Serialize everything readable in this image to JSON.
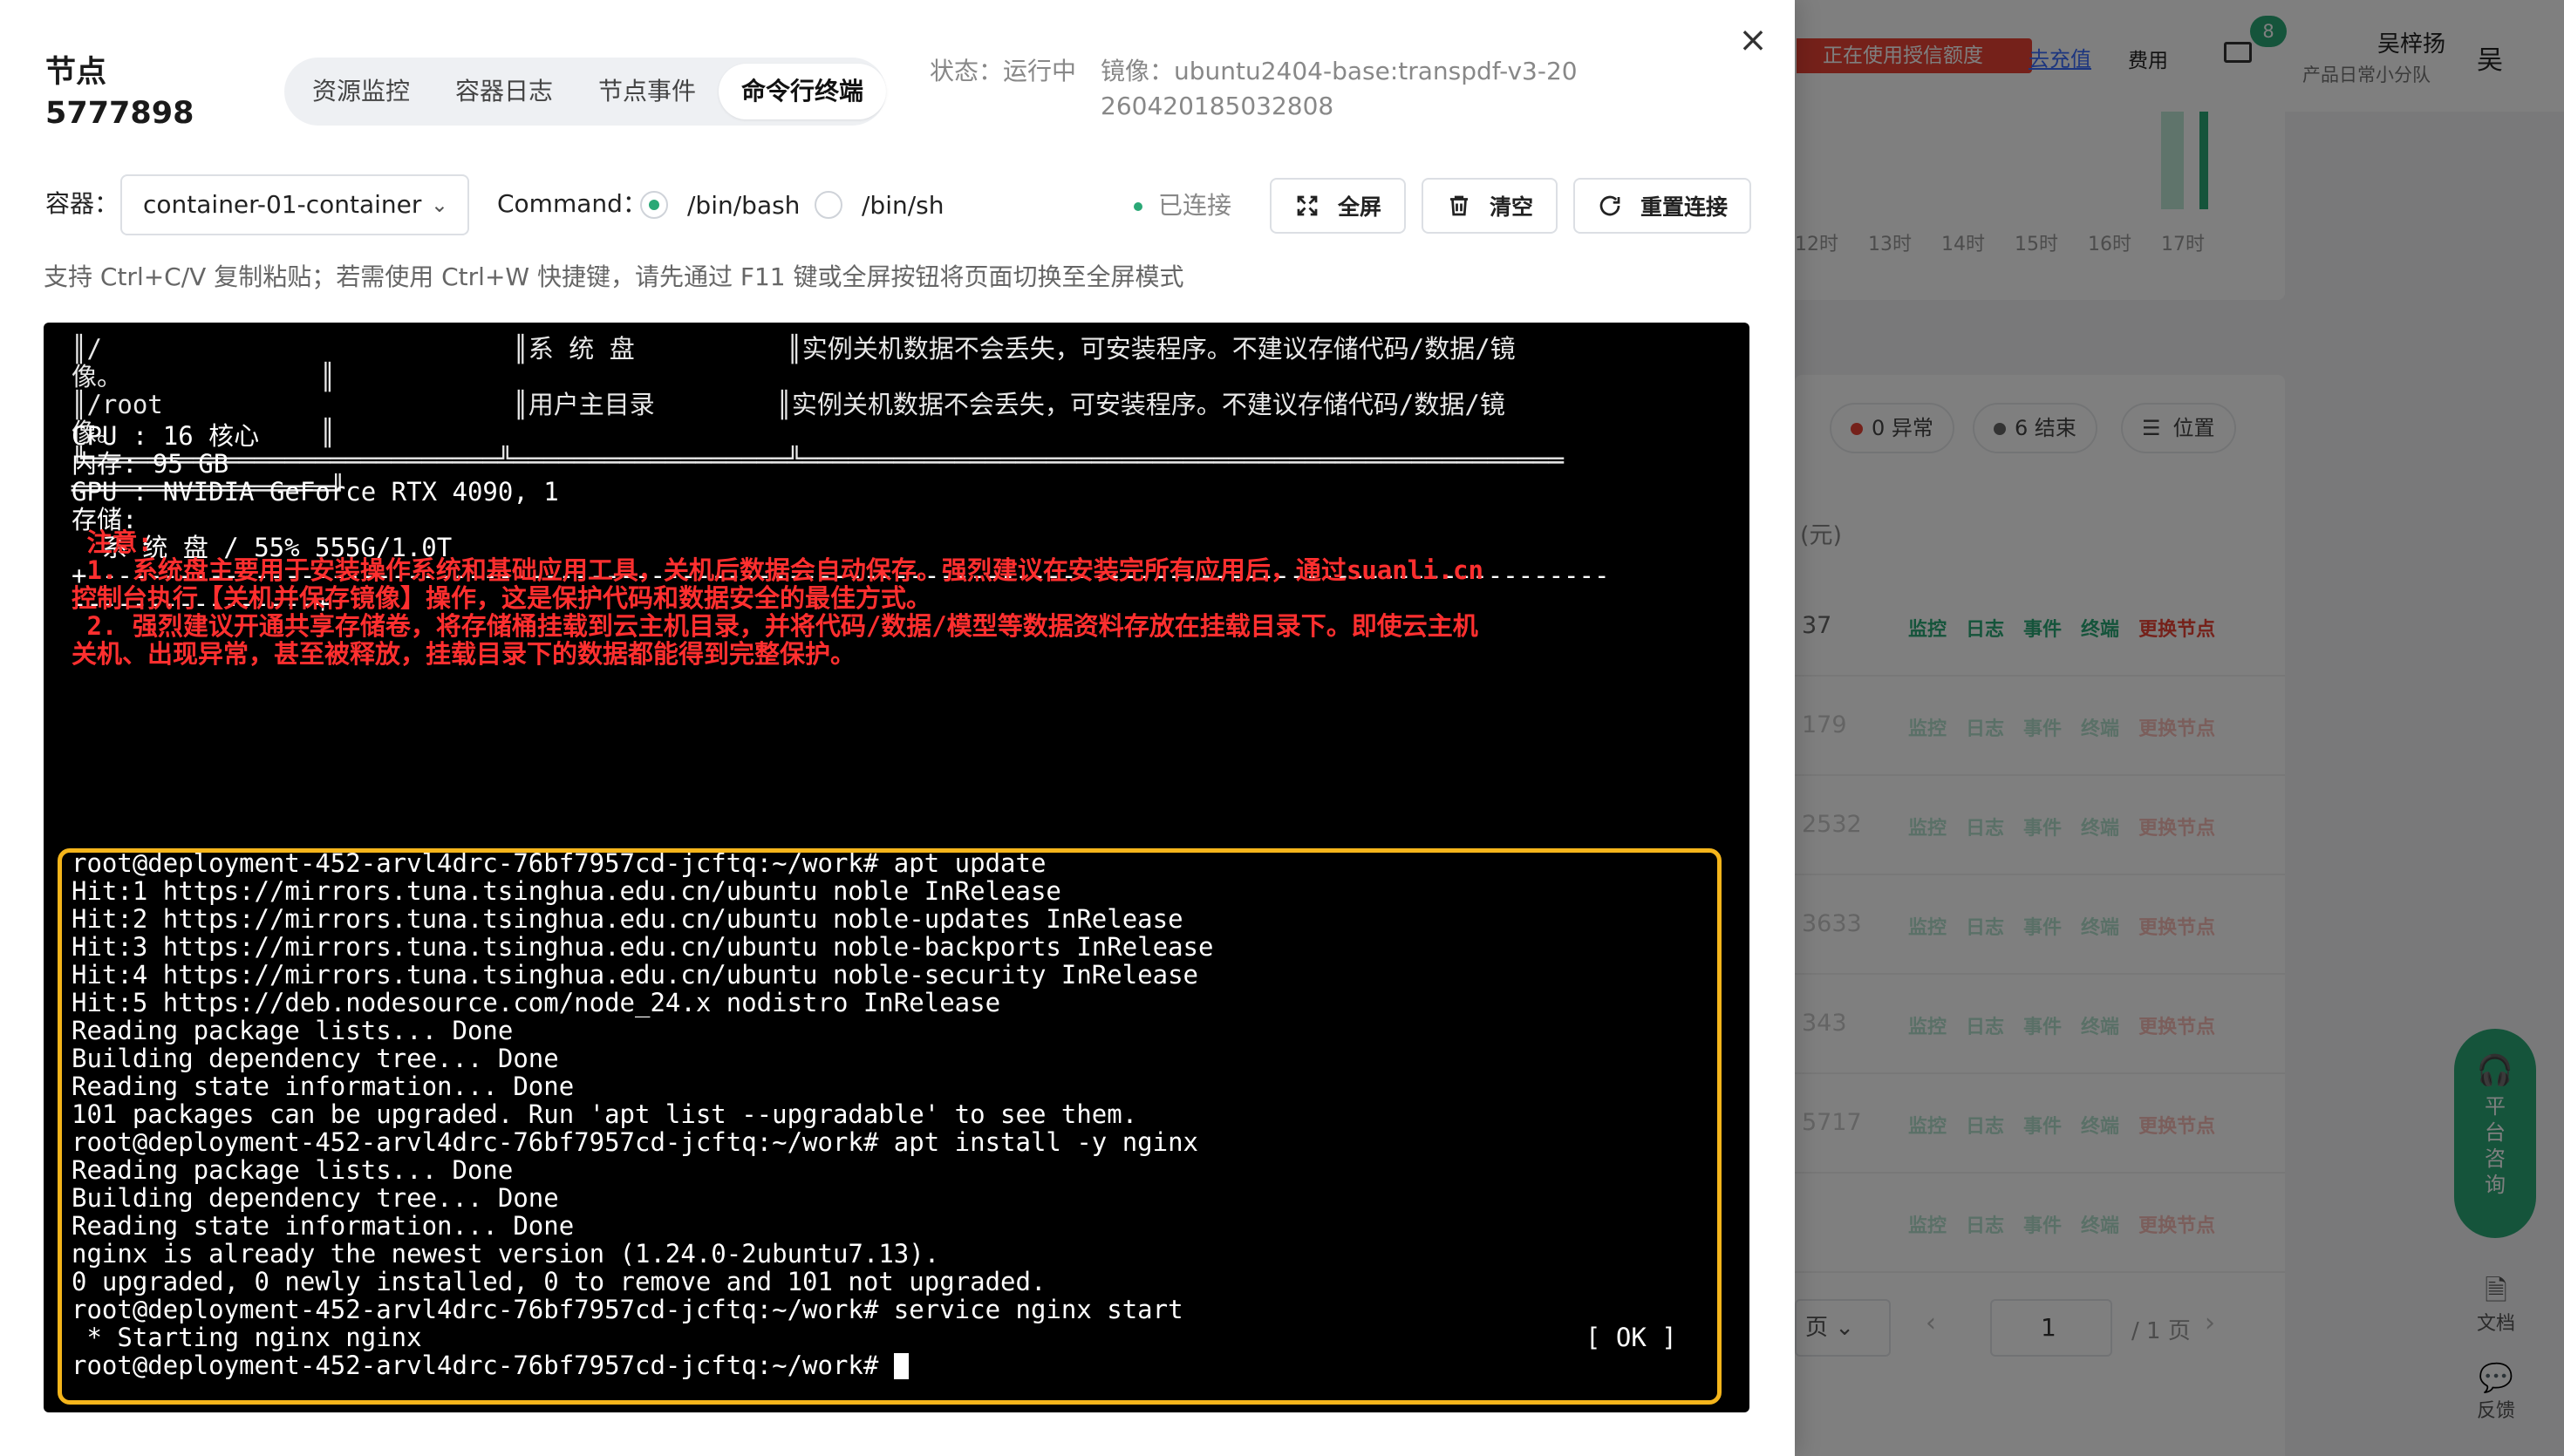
{
  "background": {
    "alert_text": "正在使用授信额度",
    "recharge_link": "去充值",
    "fee_label": "费用",
    "mail_badge": "8",
    "user_name": "吴梓扬",
    "team_name": "产品日常小分队",
    "avatar_char": "吴",
    "hours": [
      "12时",
      "13时",
      "14时",
      "15时",
      "16时",
      "17时"
    ],
    "chips": [
      {
        "label": "0 异常",
        "dot_color": "#ea4335"
      },
      {
        "label": "6 结束",
        "dot_color": "#666666"
      },
      {
        "label": "位置"
      }
    ],
    "unit_label": "(元)",
    "rows": [
      {
        "num": "37",
        "dim": false
      },
      {
        "num": "179",
        "dim": true
      },
      {
        "num": "2532",
        "dim": true
      },
      {
        "num": "3633",
        "dim": true
      },
      {
        "num": "343",
        "dim": true
      },
      {
        "num": "5717",
        "dim": true
      },
      {
        "num": "",
        "dim": true
      }
    ],
    "row_actions": [
      "监控",
      "日志",
      "事件",
      "终端",
      "更换节点"
    ],
    "pager": {
      "size_select": "页",
      "page": "1",
      "total": "/ 1 页"
    },
    "consult_label": "平台咨询",
    "docs_label": "文档",
    "feedback_label": "反馈",
    "accent_color": "#2aa876",
    "danger_color": "#ea4335"
  },
  "drawer": {
    "title_label": "节点",
    "node_id": "5777898",
    "tabs": [
      {
        "label": "资源监控",
        "active": false
      },
      {
        "label": "容器日志",
        "active": false
      },
      {
        "label": "节点事件",
        "active": false
      },
      {
        "label": "命令行终端",
        "active": true
      }
    ],
    "status_text": "状态：运行中",
    "image_text": "镜像：ubuntu2404-base:transpdf-v3-20260420185032808",
    "container_label": "容器：",
    "container_value": "container-01-container",
    "command_label": "Command：",
    "shells": [
      {
        "label": "/bin/bash",
        "selected": true
      },
      {
        "label": "/bin/sh",
        "selected": false
      }
    ],
    "connection_status": "已连接",
    "fullscreen_label": "全屏",
    "clear_label": "清空",
    "reconnect_label": "重置连接",
    "hint": "支持 Ctrl+C/V 复制粘贴；若需使用 Ctrl+W 快捷键，请先通过 F11 键或全屏按钮将页面切换至全屏模式"
  },
  "terminal": {
    "header_lines": [
      "║/                           ║系 统 盘          ║实例关机数据不会丢失，可安装程序。不建议存储代码/数据/镜",
      "像。             ║",
      "║/root                       ║用户主目录        ║实例关机数据不会丢失，可安装程序。不建议存储代码/数据/镜",
      "像。             ║",
      "╚═══════════════════════════╩══════════════════╩══════════════════════════════════════════════════",
      "═════════════════╝"
    ],
    "info_lines": [
      "CPU : 16 核心",
      "内存: 95 GB",
      "GPU : NVIDIA GeForce RTX 4090, 1",
      "存储:",
      "  系 统 盘 / 55% 555G/1.0T",
      "+----------------------------------------------------------------------------------------------------",
      "----------------+"
    ],
    "warning_lines": [
      " 注意:",
      " 1. 系统盘主要用于安装操作系统和基础应用工具，关机后数据会自动保存。强烈建议在安装完所有应用后，通过suanli.cn",
      "控制台执行【关机并保存镜像】操作，这是保护代码和数据安全的最佳方式。",
      " 2. 强烈建议开通共享存储卷，将存储桶挂载到云主机目录，并将代码/数据/模型等数据资料存放在挂载目录下。即使云主机",
      "关机、出现异常，甚至被释放，挂载目录下的数据都能得到完整保护。"
    ],
    "session_lines": [
      "root@deployment-452-arvl4drc-76bf7957cd-jcftq:~/work# apt update",
      "Hit:1 https://mirrors.tuna.tsinghua.edu.cn/ubuntu noble InRelease",
      "Hit:2 https://mirrors.tuna.tsinghua.edu.cn/ubuntu noble-updates InRelease",
      "Hit:3 https://mirrors.tuna.tsinghua.edu.cn/ubuntu noble-backports InRelease",
      "Hit:4 https://mirrors.tuna.tsinghua.edu.cn/ubuntu noble-security InRelease",
      "Hit:5 https://deb.nodesource.com/node_24.x nodistro InRelease",
      "Reading package lists... Done",
      "Building dependency tree... Done",
      "Reading state information... Done",
      "101 packages can be upgraded. Run 'apt list --upgradable' to see them.",
      "root@deployment-452-arvl4drc-76bf7957cd-jcftq:~/work# apt install -y nginx",
      "Reading package lists... Done",
      "Building dependency tree... Done",
      "Reading state information... Done",
      "nginx is already the newest version (1.24.0-2ubuntu7.13).",
      "0 upgraded, 0 newly installed, 0 to remove and 101 not upgraded.",
      "root@deployment-452-arvl4drc-76bf7957cd-jcftq:~/work# service nginx start",
      " * Starting nginx nginx"
    ],
    "ok_text": "[ OK ]",
    "prompt": "root@deployment-452-arvl4drc-76bf7957cd-jcftq:~/work# ",
    "highlight_color": "#f5b51b",
    "warning_color": "#ff2f2f"
  }
}
